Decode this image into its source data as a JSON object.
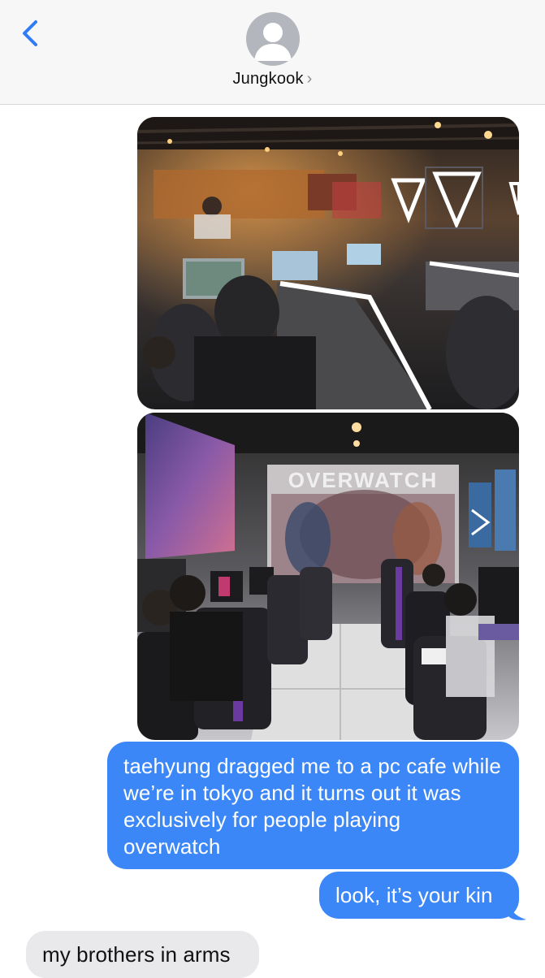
{
  "header": {
    "back_icon": "chevron-left-icon",
    "avatar_icon": "person-silhouette-icon",
    "contact_name": "Jungkook",
    "chevron": "›"
  },
  "messages": {
    "photos": [
      {
        "description_icon": "photo-pc-cafe-gaming-room"
      },
      {
        "description_icon": "photo-overwatch-themed-room"
      }
    ],
    "sent_1": "taehyung dragged me to a pc cafe while we’re in tokyo and it turns out it was exclusively for people playing overwatch",
    "sent_2": "look, it’s your kin",
    "received_1": "my brothers in arms",
    "photo2_wall_text": "OVERWATCH"
  },
  "colors": {
    "accent": "#3c87f7",
    "incoming_bubble": "#e9e9eb",
    "header_bg": "#f7f7f7"
  }
}
